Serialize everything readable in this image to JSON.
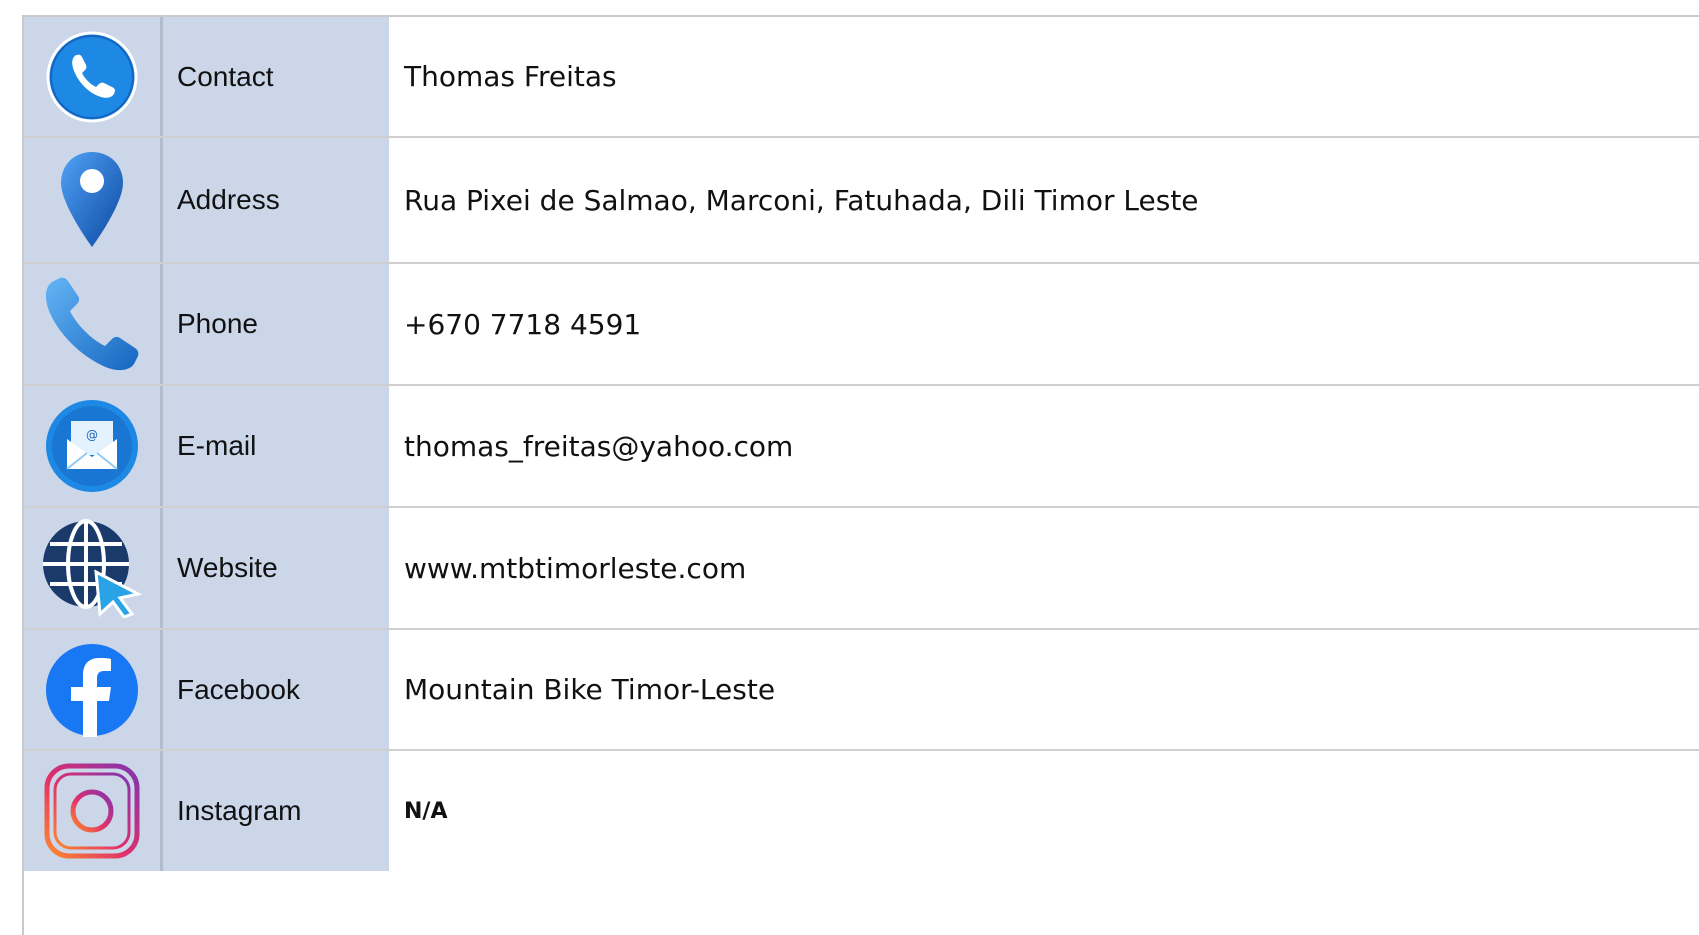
{
  "rows": [
    {
      "label": "Contact",
      "value": "Thomas Freitas",
      "icon": "phone-circle-icon"
    },
    {
      "label": "Address",
      "value": "Rua Pixei de Salmao, Marconi, Fatuhada, Dili Timor Leste",
      "icon": "map-pin-icon"
    },
    {
      "label": "Phone",
      "value": "+670 7718 4591",
      "icon": "phone-handset-icon"
    },
    {
      "label": "E-mail",
      "value": "thomas_freitas@yahoo.com",
      "icon": "email-icon"
    },
    {
      "label": "Website",
      "value": "www.mtbtimorleste.com",
      "icon": "globe-cursor-icon"
    },
    {
      "label": "Facebook",
      "value": "Mountain Bike Timor-Leste",
      "icon": "facebook-icon"
    },
    {
      "label": "Instagram",
      "value": "N/A",
      "icon": "instagram-icon"
    }
  ],
  "colors": {
    "label_background": "#cbd6e9",
    "value_background": "#ffffff",
    "accent_blue": "#1877f2"
  }
}
